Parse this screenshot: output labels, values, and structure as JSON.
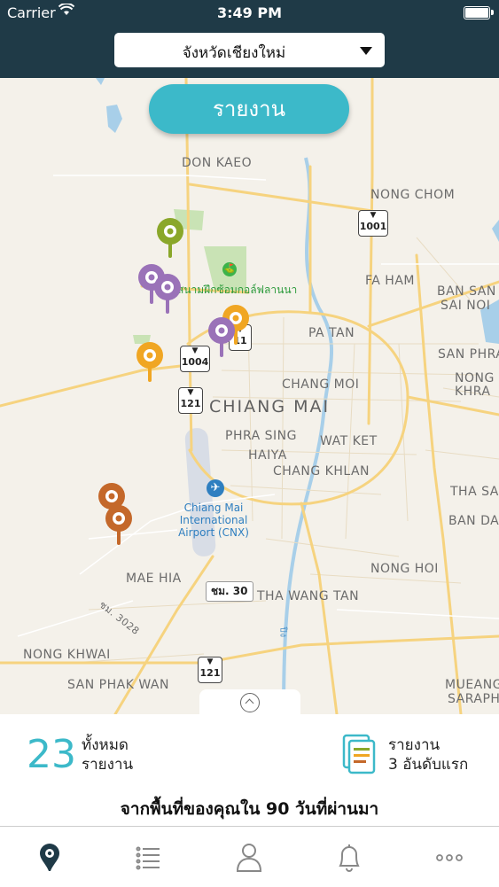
{
  "status_bar": {
    "carrier": "Carrier",
    "time": "3:49 PM"
  },
  "header": {
    "province_selector": "จังหวัดเชียงใหม่"
  },
  "map": {
    "report_button": "รายงาน",
    "labels": {
      "don_kaeo": "DON KAEO",
      "nong_chom": "NONG CHOM",
      "fa_ham": "FA HAM",
      "ban_san_sai_noi_1": "BAN SAN",
      "ban_san_sai_noi_2": "SAI NOI",
      "pa_tan": "PA TAN",
      "san_phra": "SAN PHRA",
      "nong_khra_1": "NONG",
      "nong_khra_2": "KHRA",
      "chang_moi": "CHANG MOI",
      "chiang_mai": "CHIANG MAI",
      "phra_sing": "PHRA SING",
      "haiya": "HAIYA",
      "wat_ket": "WAT KET",
      "chang_khlan": "CHANG KHLAN",
      "tha_sa": "THA SA",
      "ban_da": "BAN DA",
      "airport_1": "Chiang Mai",
      "airport_2": "International",
      "airport_3": "Airport (CNX)",
      "nong_hoi": "NONG HOI",
      "mae_hia": "MAE HIA",
      "tha_wang_tan": "THA WANG TAN",
      "nong_khwai": "NONG KHWAI",
      "san_phak_wan": "SAN PHAK WAN",
      "mueang_saraphi_1": "MUEANG",
      "mueang_saraphi_2": "SARAPHI",
      "golf": "สนามฝึกซ้อมกอล์ฟลานนา",
      "road_3028": "ชม. 3028",
      "road_30": "ชม. 30",
      "river_label": "ปิง"
    },
    "highway_shields": {
      "h1001": "1001",
      "h1004": "1004",
      "h121a": "121",
      "h121b": "121",
      "h11": "11"
    },
    "pin_colors": {
      "green": "#8aa72a",
      "purple": "#9a72b8",
      "orange": "#f0a623",
      "brown": "#c4682a"
    }
  },
  "summary": {
    "total_count": "23",
    "total_label_1": "ทั้งหมด",
    "total_label_2": "รายงาน",
    "top_label_1": "รายงาน",
    "top_label_2": "3 อันดับแรก",
    "note": "จากพื้นที่ของคุณใน 90 วันที่ผ่านมา"
  },
  "tabbar": {
    "items": [
      {
        "icon": "map-pin-icon",
        "active": true
      },
      {
        "icon": "list-icon",
        "active": false
      },
      {
        "icon": "user-icon",
        "active": false
      },
      {
        "icon": "bell-icon",
        "active": false
      },
      {
        "icon": "more-icon",
        "active": false
      }
    ]
  },
  "colors": {
    "header_bg": "#1f3a47",
    "accent": "#3cb9c9",
    "map_bg": "#f4f1ea"
  }
}
